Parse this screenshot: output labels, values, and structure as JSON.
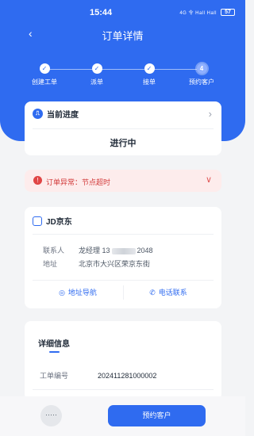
{
  "status_bar": {
    "time": "15:44",
    "system": "4G 令 Hall Hall",
    "battery": "57"
  },
  "nav": {
    "back": "‹",
    "title": "订单详情"
  },
  "steps": [
    {
      "label": "创建工单",
      "mark": "✓"
    },
    {
      "label": "派单",
      "mark": "✓"
    },
    {
      "label": "接单",
      "mark": "✓"
    },
    {
      "label": "预约客户",
      "mark": "4"
    }
  ],
  "progress": {
    "title": "当前进度",
    "value": "进行中"
  },
  "alert": {
    "text": "订单异常：节点超时"
  },
  "shop": {
    "name": "JD京东",
    "contact_label": "联系人",
    "contact_name": "龙经理 13",
    "contact_tail": "2048",
    "address_label": "地址",
    "address": "北京市大兴区荣京东街",
    "nav_action": "地址导航",
    "call_action": "电话联系"
  },
  "detail": {
    "title": "详细信息",
    "order_no_label": "工单编号",
    "order_no": "202411281000002"
  },
  "bottom": {
    "more": "·····",
    "primary": "预约客户"
  },
  "colors": {
    "accent": "#2f6bf0",
    "alert": "#d23a3a"
  }
}
